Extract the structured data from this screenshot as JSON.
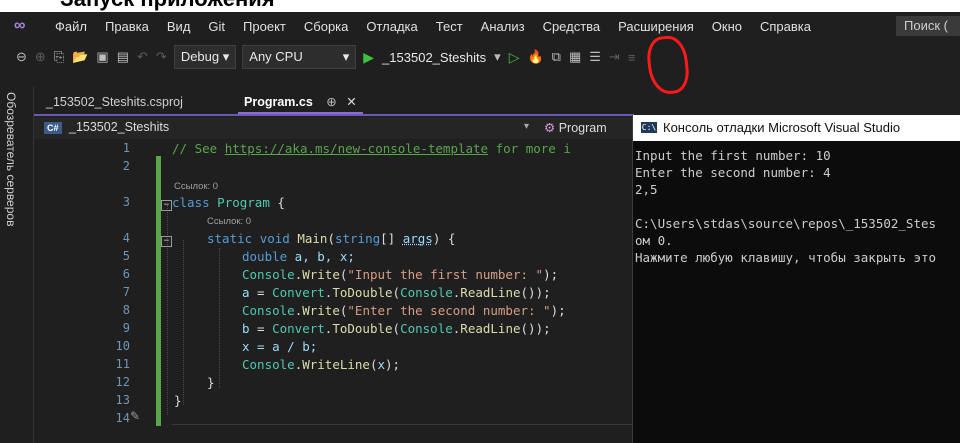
{
  "top_banner": "Запуск приложения",
  "menu": {
    "items": [
      "Файл",
      "Правка",
      "Вид",
      "Git",
      "Проект",
      "Сборка",
      "Отладка",
      "Тест",
      "Анализ",
      "Средства",
      "Расширения",
      "Окно",
      "Справка"
    ],
    "search_placeholder": "Поиск ("
  },
  "toolbar": {
    "config": "Debug",
    "config_arrow": "▾",
    "platform": "Any CPU",
    "platform_arrow": "▾",
    "run_target": "_153502_Steshits",
    "run_arrow": "▾"
  },
  "sidebar": {
    "label": "Обозреватель серверов"
  },
  "tabs": [
    {
      "label": "_153502_Steshits.csproj"
    },
    {
      "label": "Program.cs",
      "pin": "⊕",
      "close": "✕"
    }
  ],
  "navbar": {
    "badge": "C#",
    "project": "_153502_Steshits",
    "class_nav": "Program"
  },
  "editor": {
    "ref_label": "Ссылок: 0",
    "line_numbers": [
      "1",
      "2",
      "3",
      "4",
      "5",
      "6",
      "7",
      "8",
      "9",
      "10",
      "11",
      "12",
      "13",
      "14"
    ],
    "comment_prefix": "// See ",
    "comment_link": "https://aka.ms/new-console-template",
    "comment_suffix": " for more i",
    "kw_class": "class",
    "class_name": "Program",
    "brace_open": " {",
    "kw_static": "static",
    "kw_void": "void",
    "main_name": "Main",
    "main_params_1": "(",
    "kw_string": "string",
    "main_params_2": "[] ",
    "args_name": "args",
    "main_params_3": ") {",
    "kw_double": "double",
    "vars": " a, b, x;",
    "console": "Console",
    "write": "Write",
    "writeline": "WriteLine",
    "readline": "ReadLine",
    "convert": "Convert",
    "todouble": "ToDouble",
    "str_first": "\"Input the first number: \"",
    "str_second": "\"Enter the second number: \"",
    "assign_a": "a",
    "assign_b": "b",
    "assign_x": "x",
    "div_expr": " = a / b;",
    "x_arg": "x",
    "close_brace": "}"
  },
  "console_window": {
    "icon": "C:\\",
    "title": "Консоль отладки Microsoft Visual Studio",
    "lines": [
      "Input the first number: 10",
      "Enter the second number: 4",
      "2,5",
      "",
      "C:\\Users\\stdas\\source\\repos\\_153502_Stes",
      "ом 0.",
      "Нажмите любую клавишу, чтобы закрыть это"
    ]
  }
}
